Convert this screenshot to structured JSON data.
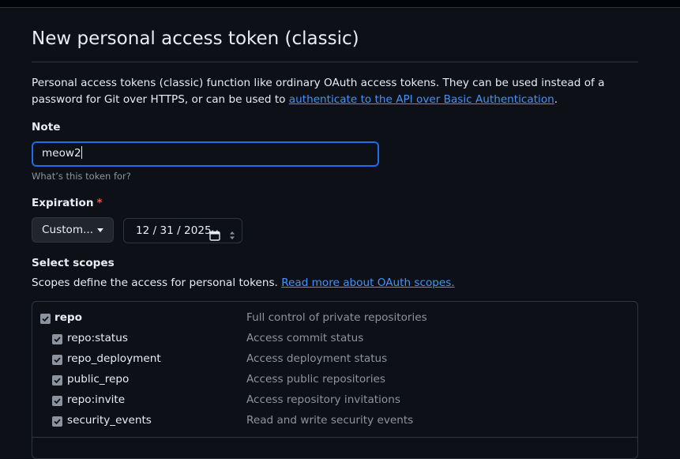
{
  "page": {
    "title": "New personal access token (classic)",
    "intro_text": "Personal access tokens (classic) function like ordinary OAuth access tokens. They can be used instead of a password for Git over HTTPS, or can be used to ",
    "intro_link": "authenticate to the API over Basic Authentication",
    "intro_end": "."
  },
  "note": {
    "label": "Note",
    "value": "meow2",
    "hint": "What’s this token for?"
  },
  "expiration": {
    "label": "Expiration",
    "required_mark": "*",
    "select_value": "Custom...",
    "date_value": "12 / 31 / 2025",
    "icons": [
      "calendar-icon",
      "spinner-arrows-icon"
    ]
  },
  "scopes": {
    "heading": "Select scopes",
    "description": "Scopes define the access for personal tokens. ",
    "link": "Read more about OAuth scopes.",
    "items": [
      {
        "name": "repo",
        "description": "Full control of private repositories",
        "checked": true,
        "parent": true
      },
      {
        "name": "repo:status",
        "description": "Access commit status",
        "checked": true,
        "parent": false
      },
      {
        "name": "repo_deployment",
        "description": "Access deployment status",
        "checked": true,
        "parent": false
      },
      {
        "name": "public_repo",
        "description": "Access public repositories",
        "checked": true,
        "parent": false
      },
      {
        "name": "repo:invite",
        "description": "Access repository invitations",
        "checked": true,
        "parent": false
      },
      {
        "name": "security_events",
        "description": "Read and write security events",
        "checked": true,
        "parent": false
      }
    ]
  },
  "colors": {
    "background": "#0d1117",
    "accent": "#1f6feb",
    "link": "#4493f8",
    "required": "#f85149",
    "muted": "#8b949e"
  }
}
